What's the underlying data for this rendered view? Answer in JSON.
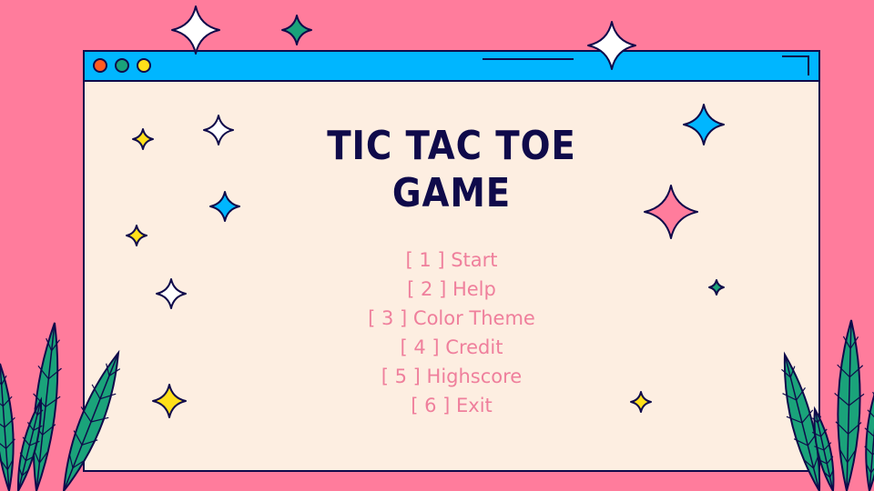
{
  "title": {
    "line1": "TIC TAC TOE",
    "line2": "GAME"
  },
  "menu": {
    "items": [
      {
        "label": "[ 1 ] Start"
      },
      {
        "label": "[ 2 ] Help"
      },
      {
        "label": "[ 3 ] Color Theme"
      },
      {
        "label": "[ 4 ] Credit"
      },
      {
        "label": "[ 5 ] Highscore"
      },
      {
        "label": "[ 6 ] Exit"
      }
    ]
  },
  "colors": {
    "background": "#ff7c9c",
    "window": "#fdeee1",
    "titlebar": "#00b6ff",
    "outline": "#0f0a4a",
    "menu_text": "#ef7f9c",
    "dot_red": "#ff5a1f",
    "dot_green": "#1aa37a",
    "dot_yellow": "#ffe01a",
    "leaf": "#1aa37a"
  }
}
